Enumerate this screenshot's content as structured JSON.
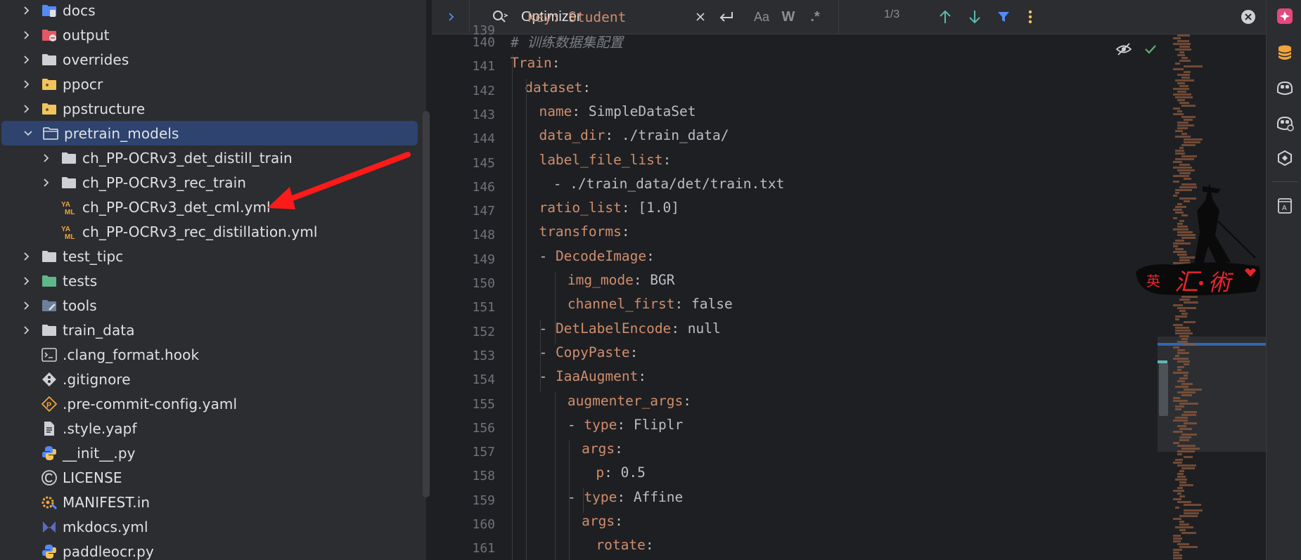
{
  "tree": {
    "items": [
      {
        "label": "docs",
        "icon": "folder-docs-icon",
        "expanded": false
      },
      {
        "label": "output",
        "icon": "folder-excluded-icon",
        "expanded": false
      },
      {
        "label": "overrides",
        "icon": "folder-icon",
        "expanded": false
      },
      {
        "label": "ppocr",
        "icon": "python-package-folder-icon",
        "expanded": false
      },
      {
        "label": "ppstructure",
        "icon": "python-package-folder-icon",
        "expanded": false
      },
      {
        "label": "pretrain_models",
        "icon": "folder-open-icon",
        "expanded": true,
        "selected": true
      },
      {
        "label": "ch_PP-OCRv3_det_distill_train",
        "icon": "folder-icon",
        "expanded": false
      },
      {
        "label": "ch_PP-OCRv3_rec_train",
        "icon": "folder-icon",
        "expanded": false
      },
      {
        "label": "ch_PP-OCRv3_det_cml.yml",
        "icon": "yaml-file-icon"
      },
      {
        "label": "ch_PP-OCRv3_rec_distillation.yml",
        "icon": "yaml-file-icon"
      },
      {
        "label": "test_tipc",
        "icon": "folder-icon",
        "expanded": false
      },
      {
        "label": "tests",
        "icon": "folder-tests-icon",
        "expanded": false
      },
      {
        "label": "tools",
        "icon": "folder-tools-icon",
        "expanded": false
      },
      {
        "label": "train_data",
        "icon": "folder-icon",
        "expanded": false
      },
      {
        "label": ".clang_format.hook",
        "icon": "shell-script-icon"
      },
      {
        "label": ".gitignore",
        "icon": "git-icon"
      },
      {
        "label": ".pre-commit-config.yaml",
        "icon": "precommit-icon"
      },
      {
        "label": ".style.yapf",
        "icon": "text-file-icon"
      },
      {
        "label": "__init__.py",
        "icon": "python-file-icon"
      },
      {
        "label": "LICENSE",
        "icon": "license-icon"
      },
      {
        "label": "MANIFEST.in",
        "icon": "manifest-gear-icon"
      },
      {
        "label": "mkdocs.yml",
        "icon": "mkdocs-icon"
      },
      {
        "label": "paddleocr.py",
        "icon": "python-file-icon"
      }
    ]
  },
  "findbar": {
    "query": "Optimizer",
    "match_count": "1/3",
    "match_case_label": "Aa",
    "words_label": "W",
    "regex_label": ".*"
  },
  "editor": {
    "partial_top_line": "  key: Student",
    "line_numbers": [
      "140",
      "141",
      "142",
      "143",
      "144",
      "145",
      "146",
      "147",
      "148",
      "149",
      "150",
      "151",
      "152",
      "153",
      "154",
      "155",
      "156",
      "157",
      "158",
      "159",
      "160",
      "161"
    ],
    "lines": [
      {
        "indent": 0,
        "parts": [
          {
            "t": "c",
            "s": "# 训练数据集配置"
          }
        ]
      },
      {
        "indent": 0,
        "parts": [
          {
            "t": "k",
            "s": "Train"
          },
          {
            "t": "v",
            "s": ":"
          }
        ]
      },
      {
        "indent": 1,
        "parts": [
          {
            "t": "k",
            "s": "dataset"
          },
          {
            "t": "v",
            "s": ":"
          }
        ]
      },
      {
        "indent": 2,
        "parts": [
          {
            "t": "k",
            "s": "name"
          },
          {
            "t": "v",
            "s": ": SimpleDataSet"
          }
        ]
      },
      {
        "indent": 2,
        "parts": [
          {
            "t": "k",
            "s": "data_dir"
          },
          {
            "t": "v",
            "s": ": ./train_data/"
          }
        ]
      },
      {
        "indent": 2,
        "parts": [
          {
            "t": "k",
            "s": "label_file_list"
          },
          {
            "t": "v",
            "s": ":"
          }
        ]
      },
      {
        "indent": 3,
        "parts": [
          {
            "t": "v",
            "s": "- ./train_data/det/train.txt"
          }
        ]
      },
      {
        "indent": 2,
        "parts": [
          {
            "t": "k",
            "s": "ratio_list"
          },
          {
            "t": "v",
            "s": ": [1.0]"
          }
        ]
      },
      {
        "indent": 2,
        "parts": [
          {
            "t": "k",
            "s": "transforms"
          },
          {
            "t": "v",
            "s": ":"
          }
        ]
      },
      {
        "indent": 2,
        "parts": [
          {
            "t": "v",
            "s": "- "
          },
          {
            "t": "k",
            "s": "DecodeImage"
          },
          {
            "t": "v",
            "s": ":"
          }
        ]
      },
      {
        "indent": 4,
        "parts": [
          {
            "t": "k",
            "s": "img_mode"
          },
          {
            "t": "v",
            "s": ": BGR"
          }
        ]
      },
      {
        "indent": 4,
        "parts": [
          {
            "t": "k",
            "s": "channel_first"
          },
          {
            "t": "v",
            "s": ": false"
          }
        ]
      },
      {
        "indent": 2,
        "parts": [
          {
            "t": "v",
            "s": "- "
          },
          {
            "t": "k",
            "s": "DetLabelEncode"
          },
          {
            "t": "v",
            "s": ": null"
          }
        ]
      },
      {
        "indent": 2,
        "parts": [
          {
            "t": "v",
            "s": "- "
          },
          {
            "t": "k",
            "s": "CopyPaste"
          },
          {
            "t": "v",
            "s": ":"
          }
        ]
      },
      {
        "indent": 2,
        "parts": [
          {
            "t": "v",
            "s": "- "
          },
          {
            "t": "k",
            "s": "IaaAugment"
          },
          {
            "t": "v",
            "s": ":"
          }
        ]
      },
      {
        "indent": 4,
        "parts": [
          {
            "t": "k",
            "s": "augmenter_args"
          },
          {
            "t": "v",
            "s": ":"
          }
        ]
      },
      {
        "indent": 4,
        "parts": [
          {
            "t": "v",
            "s": "- "
          },
          {
            "t": "k",
            "s": "type"
          },
          {
            "t": "v",
            "s": ": Fliplr"
          }
        ]
      },
      {
        "indent": 5,
        "parts": [
          {
            "t": "k",
            "s": "args"
          },
          {
            "t": "v",
            "s": ":"
          }
        ]
      },
      {
        "indent": 6,
        "parts": [
          {
            "t": "k",
            "s": "p"
          },
          {
            "t": "v",
            "s": ": 0.5"
          }
        ]
      },
      {
        "indent": 4,
        "parts": [
          {
            "t": "v",
            "s": "- "
          },
          {
            "t": "k",
            "s": "type"
          },
          {
            "t": "v",
            "s": ": Affine"
          }
        ]
      },
      {
        "indent": 5,
        "parts": [
          {
            "t": "k",
            "s": "args"
          },
          {
            "t": "v",
            "s": ":"
          }
        ]
      },
      {
        "indent": 6,
        "parts": [
          {
            "t": "k",
            "s": "rotate"
          },
          {
            "t": "v",
            "s": ":"
          }
        ]
      }
    ]
  },
  "watermark": {
    "text": "英汇の術"
  },
  "colors": {
    "key": "#cf8e6d",
    "comment": "#7a7e85",
    "selection": "#2e436e",
    "arrow": "#ff1a1a"
  }
}
